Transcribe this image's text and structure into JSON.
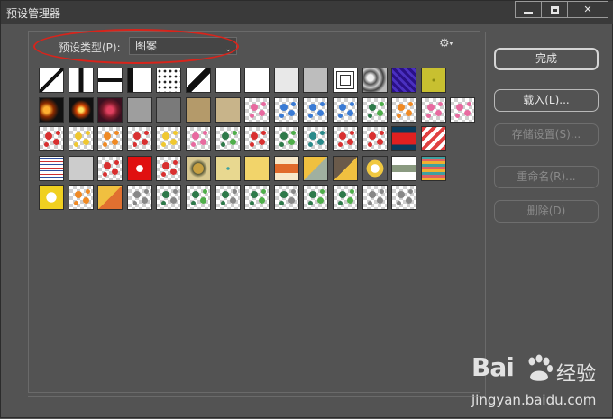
{
  "window": {
    "title": "预设管理器",
    "controls": [
      "minimize",
      "maximize",
      "close"
    ],
    "close_glyph": "✕"
  },
  "preset_type": {
    "label": "预设类型(P):",
    "selected": "图案"
  },
  "settings": {
    "icon": "gear-icon",
    "caret": "▾",
    "glyph": "⚙"
  },
  "buttons": {
    "done": "完成",
    "load": "载入(L)...",
    "save_set": "存储设置(S)...",
    "rename": "重命名(R)...",
    "delete": "删除(D)"
  },
  "patterns": {
    "rows": [
      [
        "diagonal-line",
        "vertical-bar",
        "horizontal-bar",
        "corner-block",
        "dots",
        "diagonal-steps",
        "white",
        "white",
        "light-noise",
        "gray-noise",
        "concentric-squares",
        "marble",
        "purple-waves",
        "yellow-texture"
      ],
      [
        "fire-1",
        "fire-2",
        "red-glow",
        "gray",
        "dark-gray",
        "tan-texture",
        "beige-texture",
        "pink-flower",
        "blue-butterfly",
        "blue-butterfly",
        "blue-floral",
        "green-floral",
        "orange-butterfly",
        "pink-floral",
        "pink-butterfly"
      ],
      [
        "red-floral",
        "yellow-butterfly",
        "orange-floral",
        "red-butterfly",
        "yellow-floral",
        "pink-floral",
        "green-floral",
        "red-floral",
        "green-butterfly",
        "teal-anchor",
        "red-floral",
        "red-dots",
        "red-squares",
        "chevron"
      ],
      [
        "waves",
        "blue-stripe",
        "red-grid",
        "red-star",
        "red-floral",
        "gold-circles",
        "yellow-dots",
        "yellow-solid",
        "orange-diamonds",
        "yellow-cubes",
        "brown-cubes",
        "yellow-diamond",
        "stripes",
        "zigzag"
      ],
      [
        "yellow-star",
        "orange-lattice",
        "triangle-grid",
        "floral-scatter",
        "leaf-scatter",
        "green-leaves",
        "vine",
        "green-lattice",
        "tree",
        "green-floral",
        "green-floral",
        "floral-wreath",
        "checker"
      ]
    ]
  },
  "watermark": {
    "brand": "Bai",
    "cn": "经验",
    "url": "jingyan.baidu.com"
  }
}
